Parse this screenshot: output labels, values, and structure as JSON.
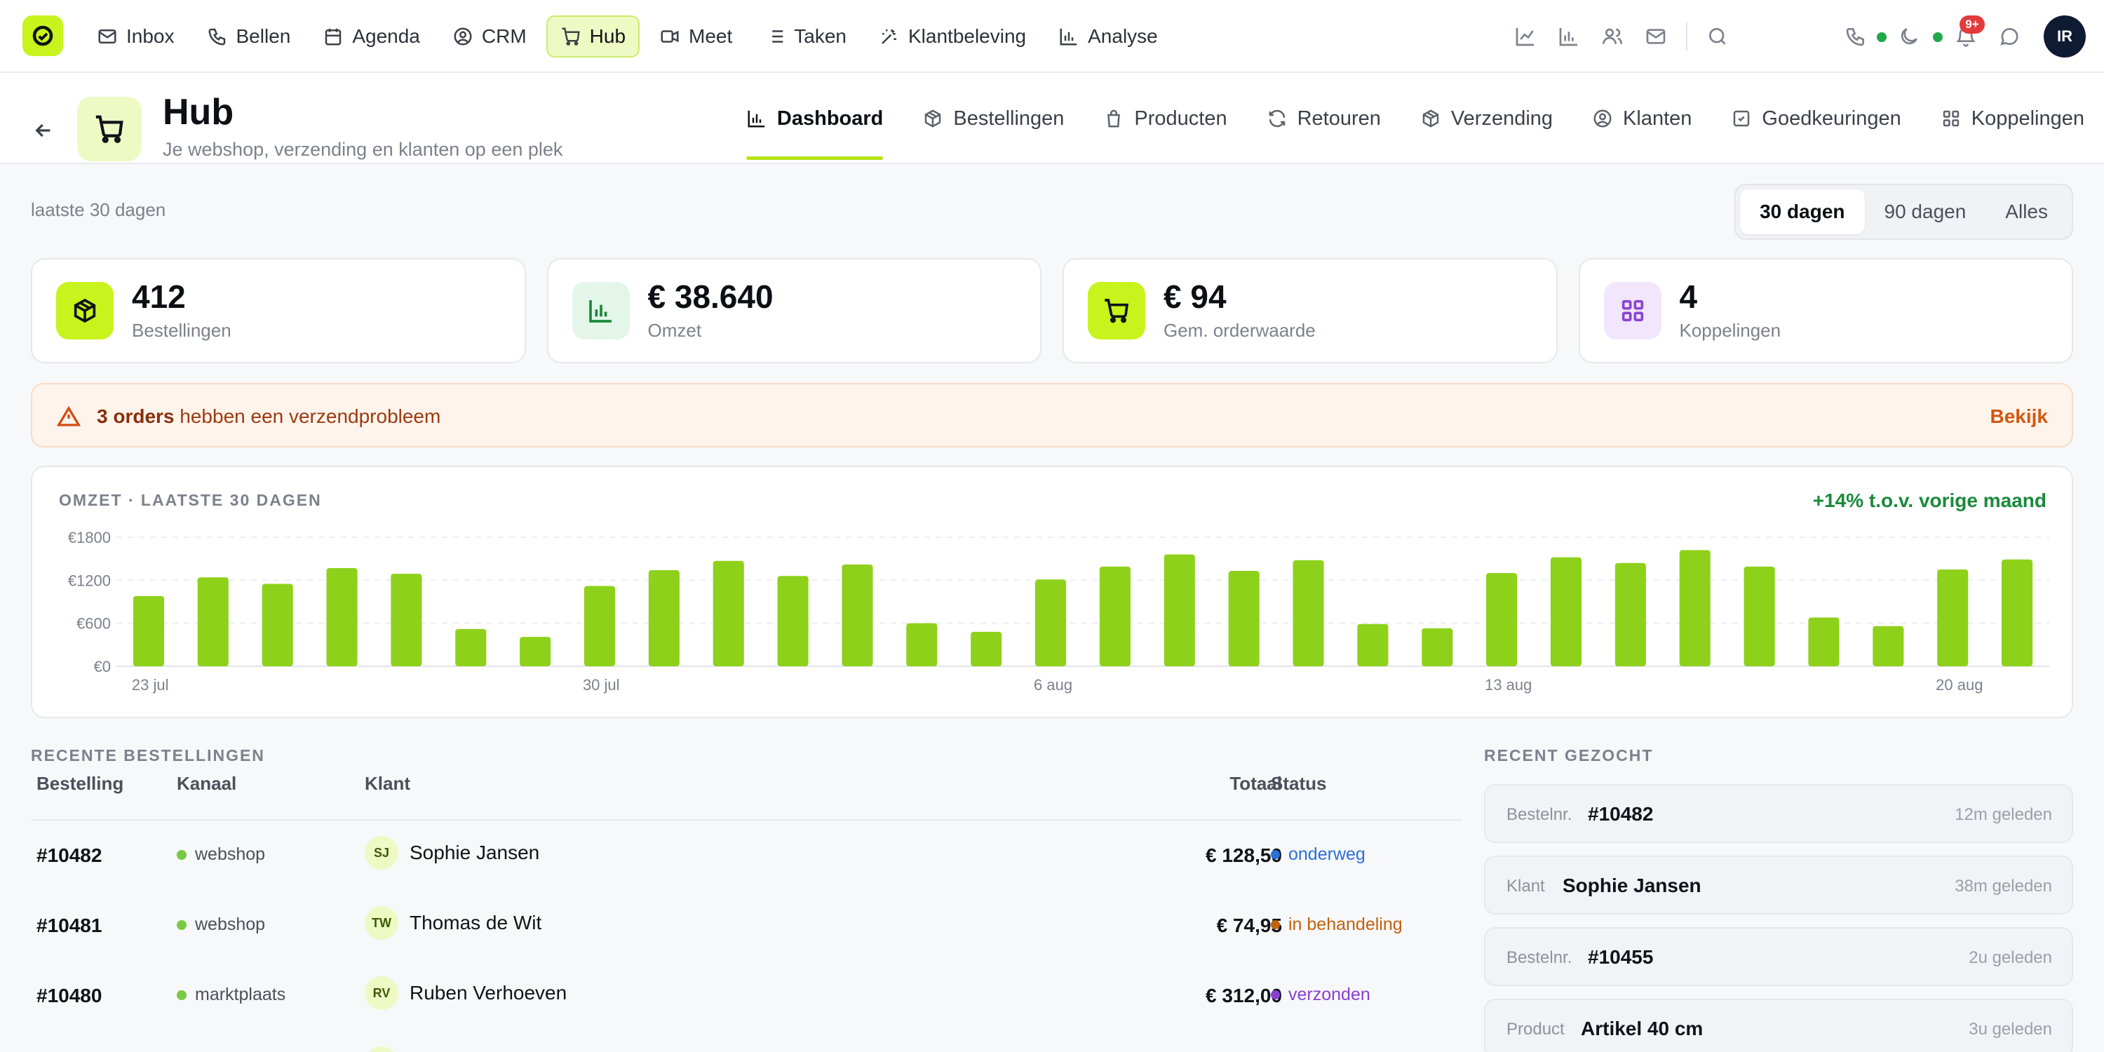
{
  "topnav": {
    "items": [
      {
        "label": "Inbox",
        "icon": "mail-icon"
      },
      {
        "label": "Bellen",
        "icon": "phone-icon"
      },
      {
        "label": "Agenda",
        "icon": "calendar-icon"
      },
      {
        "label": "CRM",
        "icon": "user-circle-icon"
      },
      {
        "label": "Hub",
        "icon": "cart-icon",
        "active": true
      },
      {
        "label": "Meet",
        "icon": "video-icon"
      },
      {
        "label": "Taken",
        "icon": "list-icon"
      },
      {
        "label": "Klantbeleving",
        "icon": "sparkle-icon"
      },
      {
        "label": "Analyse",
        "icon": "bar-chart-icon"
      }
    ],
    "notification_count": "9+",
    "user_initials": "IR"
  },
  "hub": {
    "title": "Hub",
    "subtitle": "Je webshop, verzending en klanten op een plek",
    "tabs": [
      {
        "label": "Dashboard",
        "icon": "bar-chart-icon",
        "active": true
      },
      {
        "label": "Bestellingen",
        "icon": "box-icon"
      },
      {
        "label": "Producten",
        "icon": "bag-icon"
      },
      {
        "label": "Retouren",
        "icon": "refresh-icon"
      },
      {
        "label": "Verzending",
        "icon": "box-icon"
      },
      {
        "label": "Klanten",
        "icon": "user-circle-icon"
      },
      {
        "label": "Goedkeuringen",
        "icon": "check-square-icon"
      },
      {
        "label": "Koppelingen",
        "icon": "grid-icon"
      }
    ]
  },
  "range": {
    "label": "laatste 30 dagen",
    "options": [
      "30 dagen",
      "90 dagen",
      "Alles"
    ],
    "selected": "30 dagen"
  },
  "stats": [
    {
      "value": "412",
      "label": "Bestellingen",
      "icon": "box-icon",
      "bg": "#c9f31d",
      "stroke": "#111318"
    },
    {
      "value": "€ 38.640",
      "label": "Omzet",
      "icon": "bar-chart-icon",
      "bg": "#e4f6ea",
      "stroke": "#1a8a3a"
    },
    {
      "value": "€ 94",
      "label": "Gem. orderwaarde",
      "icon": "cart-icon",
      "bg": "#c9f31d",
      "stroke": "#111318"
    },
    {
      "value": "4",
      "label": "Koppelingen",
      "icon": "grid-icon",
      "bg": "#f1e6fb",
      "stroke": "#8a44d2"
    }
  ],
  "alert": {
    "bold": "3 orders",
    "text": " hebben een verzendprobleem",
    "action": "Bekijk"
  },
  "chart_data": {
    "type": "bar",
    "title": "OMZET · LAATSTE 30 DAGEN",
    "delta": "+14% t.o.v. vorige maand",
    "ylim": [
      0,
      1800
    ],
    "yticks": [
      "€0",
      "€600",
      "€1200",
      "€1800"
    ],
    "ytick_values": [
      0,
      600,
      1200,
      1800
    ],
    "xtick_labels": [
      {
        "index": 0,
        "label": "23 jul"
      },
      {
        "index": 7,
        "label": "30 jul"
      },
      {
        "index": 14,
        "label": "6 aug"
      },
      {
        "index": 21,
        "label": "13 aug"
      },
      {
        "index": 28,
        "label": "20 aug"
      }
    ],
    "values": [
      980,
      1240,
      1150,
      1370,
      1290,
      520,
      410,
      1120,
      1340,
      1470,
      1260,
      1420,
      600,
      480,
      1210,
      1390,
      1560,
      1330,
      1480,
      590,
      530,
      1300,
      1520,
      1440,
      1620,
      1390,
      680,
      560,
      1350,
      1490
    ],
    "color": "#8ed11a",
    "grid": true
  },
  "orders": {
    "section_label": "RECENTE BESTELLINGEN",
    "headers": {
      "id": "Bestelling",
      "channel": "Kanaal",
      "client": "Klant",
      "total": "Totaal",
      "status": "Status"
    },
    "rows": [
      {
        "id": "#10482",
        "channel": "webshop",
        "initials": "SJ",
        "client": "Sophie Jansen",
        "total": "€ 128,50",
        "status": "onderweg",
        "status_color": "#2c6fd6"
      },
      {
        "id": "#10481",
        "channel": "webshop",
        "initials": "TW",
        "client": "Thomas de Wit",
        "total": "€ 74,95",
        "status": "in behandeling",
        "status_color": "#c2620e"
      },
      {
        "id": "#10480",
        "channel": "marktplaats",
        "initials": "RV",
        "client": "Ruben Verhoeven",
        "total": "€ 312,00",
        "status": "verzonden",
        "status_color": "#8a3fd2"
      }
    ]
  },
  "recent_searches": {
    "section_label": "RECENT GEZOCHT",
    "items": [
      {
        "kind": "Bestelnr.",
        "value": "#10482",
        "time": "12m geleden"
      },
      {
        "kind": "Klant",
        "value": "Sophie Jansen",
        "time": "38m geleden"
      },
      {
        "kind": "Bestelnr.",
        "value": "#10455",
        "time": "2u geleden"
      },
      {
        "kind": "Product",
        "value": "Artikel 40 cm",
        "time": "3u geleden"
      }
    ]
  }
}
